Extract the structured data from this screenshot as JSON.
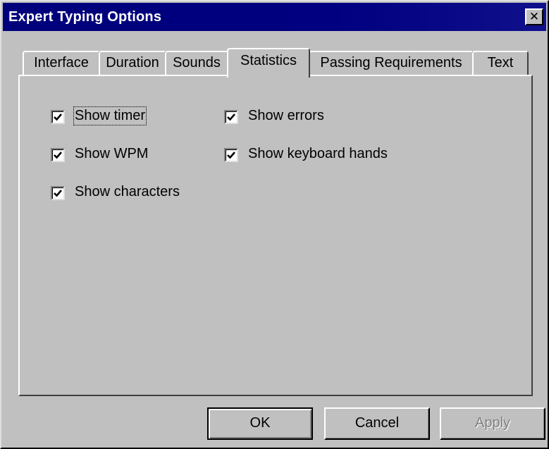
{
  "window": {
    "title": "Expert Typing Options",
    "close_label": "✕"
  },
  "tabs": [
    {
      "label": "Interface"
    },
    {
      "label": "Duration"
    },
    {
      "label": "Sounds"
    },
    {
      "label": "Statistics",
      "active": true
    },
    {
      "label": "Passing Requirements"
    },
    {
      "label": "Text"
    }
  ],
  "options": {
    "show_timer": {
      "label": "Show timer",
      "checked": true
    },
    "show_wpm": {
      "label": "Show WPM",
      "checked": true
    },
    "show_characters": {
      "label": "Show characters",
      "checked": true
    },
    "show_errors": {
      "label": "Show errors",
      "checked": true
    },
    "show_keyboard_hands": {
      "label": "Show keyboard hands",
      "checked": true
    }
  },
  "buttons": {
    "ok": "OK",
    "cancel": "Cancel",
    "apply": "Apply"
  }
}
